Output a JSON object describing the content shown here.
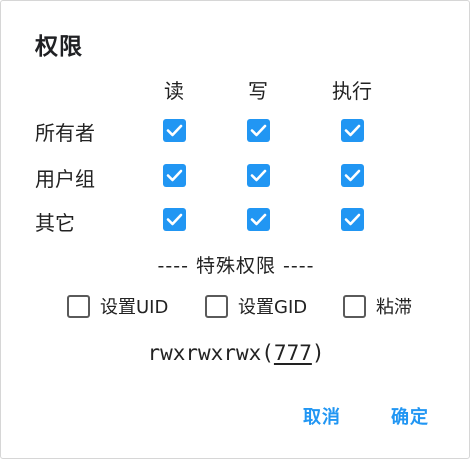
{
  "dialog": {
    "title": "权限",
    "columns": [
      "读",
      "写",
      "执行"
    ],
    "rows": [
      {
        "label": "所有者",
        "read": true,
        "write": true,
        "execute": true
      },
      {
        "label": "用户组",
        "read": true,
        "write": true,
        "execute": true
      },
      {
        "label": "其它",
        "read": true,
        "write": true,
        "execute": true
      }
    ],
    "special_header": "---- 特殊权限 ----",
    "special": [
      {
        "label": "设置UID",
        "checked": false
      },
      {
        "label": "设置GID",
        "checked": false
      },
      {
        "label": "粘滞",
        "checked": false
      }
    ],
    "mode_string": "rwxrwxrwx",
    "octal": "777",
    "open_paren": "(",
    "close_paren": ")",
    "buttons": {
      "cancel": "取消",
      "confirm": "确定"
    }
  },
  "colors": {
    "accent": "#2196f3",
    "checkbox_border": "#5a5a5a"
  }
}
